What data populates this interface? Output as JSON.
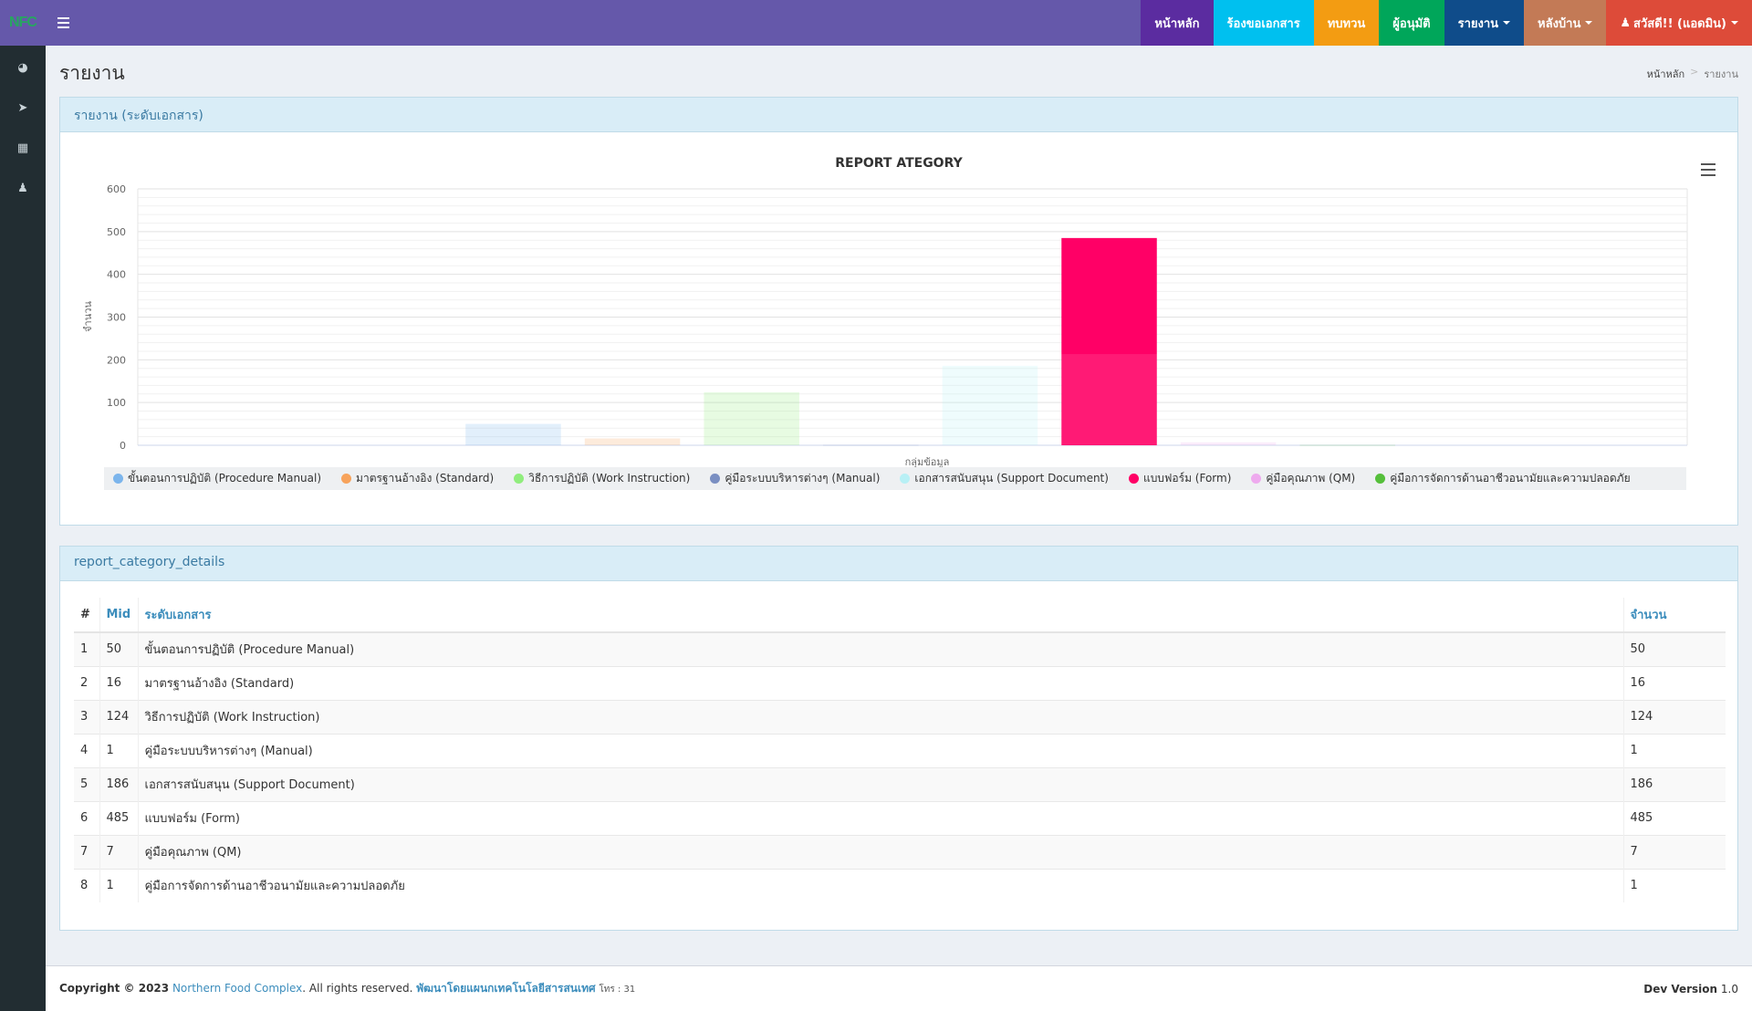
{
  "app": {
    "logo": "NFC"
  },
  "nav": [
    {
      "label": "หน้าหลัก",
      "color": "#5b2ca0",
      "dropdown": false
    },
    {
      "label": "ร้องขอเอกสาร",
      "color": "#00c0ef",
      "dropdown": false
    },
    {
      "label": "ทบทวน",
      "color": "#f39c12",
      "dropdown": false
    },
    {
      "label": "ผู้อนุมัติ",
      "color": "#00a65a",
      "dropdown": false
    },
    {
      "label": "รายงาน",
      "color": "#0f4c8a",
      "dropdown": true
    },
    {
      "label": "หลังบ้าน",
      "color": "#c37a56",
      "dropdown": true
    },
    {
      "label": "สวัสดี!! (แอดมิน)",
      "color": "#dd4b39",
      "dropdown": true
    }
  ],
  "sidebar": [
    {
      "icon": "dashboard-icon",
      "glyph": "◕"
    },
    {
      "icon": "paper-plane-icon",
      "glyph": "➤"
    },
    {
      "icon": "calendar-icon",
      "glyph": "▦"
    },
    {
      "icon": "user-icon",
      "glyph": "♟"
    }
  ],
  "page": {
    "title": "รายงาน",
    "breadcrumb_home": "หน้าหลัก",
    "breadcrumb_sep": ">",
    "breadcrumb_current": "รายงาน"
  },
  "report_box": {
    "title": "รายงาน (ระดับเอกสาร)"
  },
  "details_box": {
    "title": "report_category_details"
  },
  "chart_data": {
    "type": "bar",
    "title": "REPORT ATEGORY",
    "xlabel": "กลุ่มข้อมูล",
    "ylabel": "จำนวน",
    "ylim": [
      0,
      600
    ],
    "yticks": [
      0,
      100,
      200,
      300,
      400,
      500,
      600
    ],
    "grid": true,
    "legend": "bottom",
    "series": [
      {
        "name": "ขั้นตอนการปฏิบัติ (Procedure Manual)",
        "value": 50,
        "color": "#7cb5ec"
      },
      {
        "name": "มาตรฐานอ้างอิง (Standard)",
        "value": 16,
        "color": "#f7a35c"
      },
      {
        "name": "วิธีการปฏิบัติ (Work Instruction)",
        "value": 124,
        "color": "#90ed7d"
      },
      {
        "name": "คู่มือระบบบริหารต่างๆ (Manual)",
        "value": 1,
        "color": "#7a8fc2"
      },
      {
        "name": "เอกสารสนับสนุน (Support Document)",
        "value": 186,
        "color": "#b8f0f5"
      },
      {
        "name": "แบบฟอร์ม (Form)",
        "value": 485,
        "color": "#ff0066"
      },
      {
        "name": "คู่มือคุณภาพ (QM)",
        "value": 7,
        "color": "#eeaaee"
      },
      {
        "name": "คู่มือการจัดการด้านอาชีวอนามัยและความปลอดภัย",
        "value": 1,
        "color": "#55bf3b"
      }
    ]
  },
  "table": {
    "headers": [
      "#",
      "Mid",
      "ระดับเอกสาร",
      "จำนวน"
    ],
    "rows": [
      {
        "no": "1",
        "mid": "50",
        "level": "ขั้นตอนการปฏิบัติ (Procedure Manual)",
        "count": "50"
      },
      {
        "no": "2",
        "mid": "16",
        "level": "มาตรฐานอ้างอิง (Standard)",
        "count": "16"
      },
      {
        "no": "3",
        "mid": "124",
        "level": "วิธีการปฏิบัติ (Work Instruction)",
        "count": "124"
      },
      {
        "no": "4",
        "mid": "1",
        "level": "คู่มือระบบบริหารต่างๆ (Manual)",
        "count": "1"
      },
      {
        "no": "5",
        "mid": "186",
        "level": "เอกสารสนับสนุน (Support Document)",
        "count": "186"
      },
      {
        "no": "6",
        "mid": "485",
        "level": "แบบฟอร์ม (Form)",
        "count": "485"
      },
      {
        "no": "7",
        "mid": "7",
        "level": "คู่มือคุณภาพ (QM)",
        "count": "7"
      },
      {
        "no": "8",
        "mid": "1",
        "level": "คู่มือการจัดการด้านอาชีวอนามัยและความปลอดภัย",
        "count": "1"
      }
    ]
  },
  "footer": {
    "copyright": "Copyright © 2023",
    "company": "Northern Food Complex",
    "rights": ". All rights reserved.",
    "developer": "พัฒนาโดยแผนกเทคโนโลยีสารสนเทศ",
    "phone": "โทร : 31",
    "version_label": "Dev Version",
    "version": "1.0"
  }
}
